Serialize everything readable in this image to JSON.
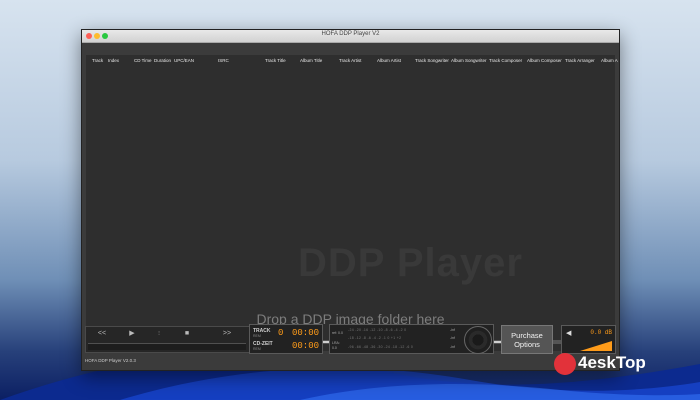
{
  "window": {
    "title": "HOFA DDP Player V2"
  },
  "tracklist": {
    "columns": [
      "Track",
      "Index",
      "CD Time",
      "Duration",
      "UPC/EAN",
      "ISRC",
      "Track Title",
      "Album Title",
      "Track Artist",
      "Album Artist",
      "Track Songwriter",
      "Album Songwriter",
      "Track Composer",
      "Album Composer",
      "Track Arranger",
      "Album A"
    ],
    "watermark": "DDP Player",
    "drop_text": "Drop a DDP image folder here"
  },
  "transport": {
    "rewind": "<<",
    "play": "▶",
    "stop": "■",
    "forward": ">>"
  },
  "counter": {
    "track_label": "TRACK",
    "track_sub": "REM",
    "track_num": "0",
    "track_time": "00:00",
    "cd_label": "CD-ZEIT",
    "cd_sub": "REM",
    "cd_time": "00:00"
  },
  "meter": {
    "ref_label": "ref: 0.0",
    "row1": "-24 -20 -16 -12 -10 -8 -6 -4 -2 0",
    "row2": "-18 -12 -8 -6 -4 -2 -1 0 +1 +2",
    "row3": "-96 -66 -48 -36 -30 -24 -18 -12 -6 0",
    "lufs_label": "LRA:",
    "lufs_val": "0.0",
    "right_labels": [
      "-inf",
      "-inf",
      "-inf"
    ]
  },
  "purchase": {
    "line1": "Purchase",
    "line2": "Options"
  },
  "volume": {
    "value": "0.0 dB",
    "icon": "speaker-icon",
    "accent": "#ff9c1a"
  },
  "status": {
    "text": "HOFA DDP Player V2.0.3"
  },
  "overlay": {
    "brand": "4eskTop"
  }
}
